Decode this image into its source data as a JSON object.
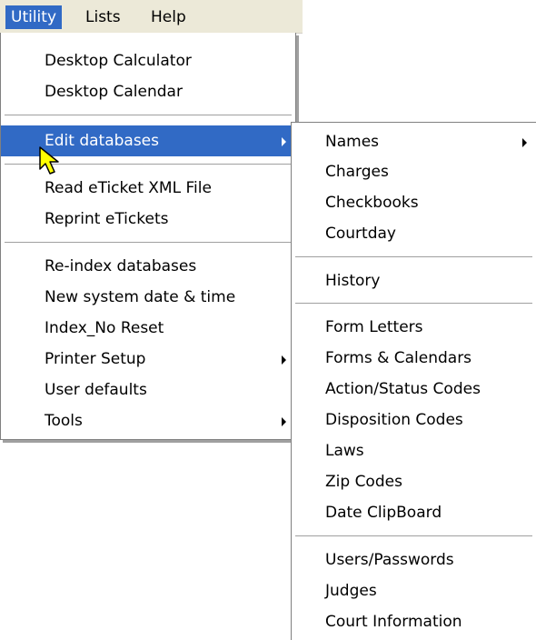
{
  "menubar": {
    "items": [
      {
        "label": "Utility"
      },
      {
        "label": "Lists"
      },
      {
        "label": "Help"
      }
    ]
  },
  "utility_menu": {
    "items": [
      {
        "label": "Desktop Calculator"
      },
      {
        "label": "Desktop Calendar"
      },
      {
        "label": "Edit databases"
      },
      {
        "label": "Read eTicket XML File"
      },
      {
        "label": "Reprint eTickets"
      },
      {
        "label": "Re-index databases"
      },
      {
        "label": "New system date & time"
      },
      {
        "label": "Index_No Reset"
      },
      {
        "label": "Printer Setup"
      },
      {
        "label": "User defaults"
      },
      {
        "label": "Tools"
      }
    ]
  },
  "edit_databases_submenu": {
    "items": [
      {
        "label": "Names"
      },
      {
        "label": "Charges"
      },
      {
        "label": "Checkbooks"
      },
      {
        "label": "Courtday"
      },
      {
        "label": "History"
      },
      {
        "label": "Form Letters"
      },
      {
        "label": "Forms & Calendars"
      },
      {
        "label": "Action/Status Codes"
      },
      {
        "label": "Disposition Codes"
      },
      {
        "label": "Laws"
      },
      {
        "label": "Zip Codes"
      },
      {
        "label": "Date ClipBoard"
      },
      {
        "label": "Users/Passwords"
      },
      {
        "label": "Judges"
      },
      {
        "label": "Court Information"
      }
    ]
  },
  "colors": {
    "highlight": "#316ac5",
    "menubar_bg": "#ece9d8",
    "cursor_fill": "#ffff00"
  },
  "icons": {
    "submenu_arrow": "chevron-right-icon",
    "mouse_cursor": "arrow-cursor-icon"
  }
}
